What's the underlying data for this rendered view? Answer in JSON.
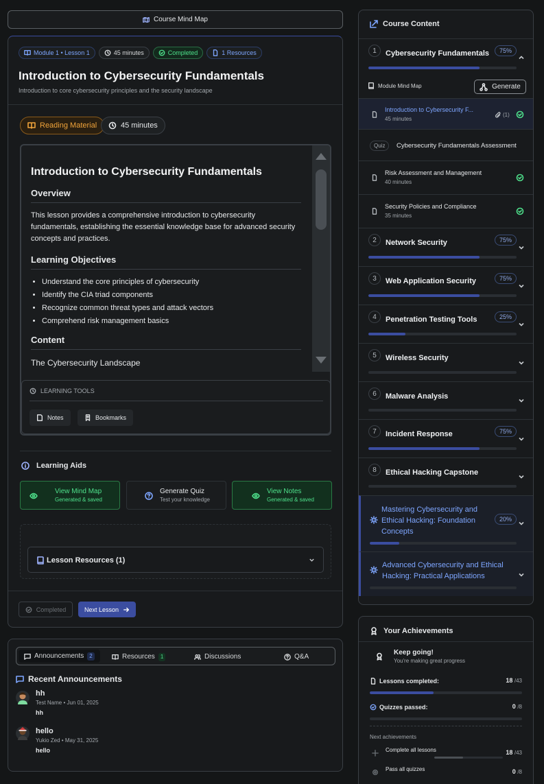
{
  "header_button": {
    "label": "Course Mind Map"
  },
  "lesson": {
    "badges": {
      "module": "Module 1 • Lesson 1",
      "duration": "45 minutes",
      "status": "Completed",
      "resources": "1 Resources"
    },
    "title": "Introduction to Cybersecurity Fundamentals",
    "subtitle": "Introduction to core cybersecurity principles and the security landscape",
    "type_badge": "Reading Material",
    "time_badge": "45 minutes"
  },
  "reader": {
    "h1": "Introduction to Cybersecurity Fundamentals",
    "overview_heading": "Overview",
    "overview_text": "This lesson provides a comprehensive introduction to cybersecurity fundamentals, establishing the essential knowledge base for advanced security concepts and practices.",
    "objectives_heading": "Learning Objectives",
    "objectives": [
      "Understand the core principles of cybersecurity",
      "Identify the CIA triad components",
      "Recognize common threat types and attack vectors",
      "Comprehend risk management basics"
    ],
    "content_heading": "Content",
    "content_subheading": "The Cybersecurity Landscape"
  },
  "learning_tools": {
    "heading": "LEARNING TOOLS",
    "notes": "Notes",
    "bookmarks": "Bookmarks"
  },
  "learning_aids": {
    "heading": "Learning Aids",
    "mind_map": {
      "title": "View Mind Map",
      "sub": "Generated & saved"
    },
    "quiz": {
      "title": "Generate Quiz",
      "sub": "Test your knowledge"
    },
    "notes": {
      "title": "View Notes",
      "sub": "Generated & saved"
    }
  },
  "resources_section": {
    "label": "Lesson Resources (1)"
  },
  "footer_buttons": {
    "completed": "Completed",
    "next": "Next Lesson"
  },
  "bottom_tabs": {
    "announcements": "Announcements",
    "announcements_count": "2",
    "resources": "Resources",
    "resources_count": "1",
    "discussions": "Discussions",
    "qa": "Q&A"
  },
  "announcements": {
    "heading": "Recent Announcements",
    "items": [
      {
        "title": "hh",
        "meta": "Test Name • Jun 01, 2025",
        "body": "hh"
      },
      {
        "title": "hello",
        "meta": "Yukio Zed • May 31, 2025",
        "body": "hello"
      }
    ]
  },
  "course_content": {
    "heading": "Course Content",
    "module1": {
      "num": "1",
      "title": "Cybersecurity Fundamentals",
      "pct": "75%",
      "progress": 0.75
    },
    "mind_map_label": "Module Mind Map",
    "generate_label": "Generate",
    "lessons": [
      {
        "title": "Introduction to Cybersecurity F...",
        "duration": "45 minutes",
        "attach": "(1)"
      },
      {
        "quiz_tag": "Quiz",
        "title": "Cybersecurity Fundamentals Assessment"
      },
      {
        "title": "Risk Assessment and Management",
        "duration": "40 minutes"
      },
      {
        "title": "Security Policies and Compliance",
        "duration": "35 minutes"
      }
    ],
    "modules": [
      {
        "num": "2",
        "title": "Network Security",
        "pct": "75%",
        "progress": 0.75
      },
      {
        "num": "3",
        "title": "Web Application Security",
        "pct": "75%",
        "progress": 0.75
      },
      {
        "num": "4",
        "title": "Penetration Testing Tools",
        "pct": "25%",
        "progress": 0.25
      },
      {
        "num": "5",
        "title": "Wireless Security",
        "pct": "",
        "progress": 0
      },
      {
        "num": "6",
        "title": "Malware Analysis",
        "pct": "",
        "progress": 0
      },
      {
        "num": "7",
        "title": "Incident Response",
        "pct": "75%",
        "progress": 0.75
      },
      {
        "num": "8",
        "title": "Ethical Hacking Capstone",
        "pct": "",
        "progress": 0
      }
    ],
    "special1": {
      "title": "Mastering Cybersecurity and Ethical Hacking: Foundation Concepts",
      "pct": "20%",
      "progress": 0.2
    },
    "special2": {
      "title": "Advanced Cybersecurity and Ethical Hacking: Practical Applications",
      "progress": 0
    }
  },
  "achievements": {
    "heading": "Your Achievements",
    "status_title": "Keep going!",
    "status_sub": "You're making great progress",
    "lessons_label": "Lessons completed:",
    "lessons_value": "18",
    "lessons_total": "/43",
    "quizzes_label": "Quizzes passed:",
    "quizzes_value": "0",
    "quizzes_total": "/8",
    "next_heading": "Next achievements",
    "next1_label": "Complete all lessons",
    "next1_value": "18",
    "next1_total": "/43",
    "next2_label": "Pass all quizzes",
    "next2_value": "0",
    "next2_total": "/8"
  },
  "colors": {
    "accent": "#3b4da0",
    "success": "#4ee08b",
    "warning": "#f0a33a",
    "bg": "#141617"
  }
}
